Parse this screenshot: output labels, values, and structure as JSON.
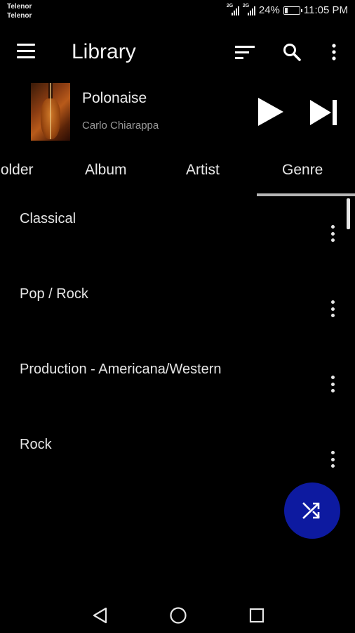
{
  "status_bar": {
    "carrier_1": "Telenor",
    "carrier_2": "Telenor",
    "signal_1_tag": "2G",
    "signal_2_tag": "2G",
    "battery": "24%",
    "battery_level": 0.24,
    "time": "11:05 PM"
  },
  "toolbar": {
    "title": "Library",
    "menu_icon": "hamburger-menu-icon",
    "sort_icon": "sort-icon",
    "search_icon": "search-icon",
    "more_icon": "more-vert-icon"
  },
  "now_playing": {
    "title": "Polonaise",
    "artist": "Carlo Chiarappa",
    "play_icon": "play-icon",
    "next_icon": "skip-next-icon"
  },
  "tabs": [
    {
      "label": "Folder"
    },
    {
      "label": "Album"
    },
    {
      "label": "Artist"
    },
    {
      "label": "Genre",
      "selected": true
    }
  ],
  "genres": [
    {
      "label": "Classical"
    },
    {
      "label": "Pop / Rock"
    },
    {
      "label": "Production - Americana/Western"
    },
    {
      "label": "Rock"
    }
  ],
  "fab": {
    "icon": "shuffle-icon",
    "color": "#0d1aa0"
  },
  "nav_bar": {
    "back_icon": "back-triangle-icon",
    "home_icon": "home-circle-icon",
    "recents_icon": "recents-square-icon"
  }
}
